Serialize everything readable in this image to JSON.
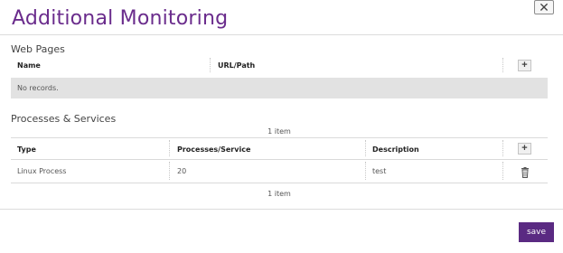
{
  "dialog": {
    "title": "Additional Monitoring",
    "close_label": "✕",
    "save_label": "save"
  },
  "web_pages": {
    "title": "Web Pages",
    "columns": [
      "Name",
      "URL/Path"
    ],
    "add_label": "+",
    "empty_text": "No records."
  },
  "processes": {
    "title": "Processes & Services",
    "pager_top": "1 item",
    "pager_bottom": "1 item",
    "columns": [
      "Type",
      "Processes/Service",
      "Description"
    ],
    "add_label": "+",
    "rows": [
      {
        "type": "Linux Process",
        "service": "20",
        "description": "test"
      }
    ]
  },
  "colors": {
    "title": "#6a2c8c",
    "save_button": "#5a2a82",
    "empty_row": "#e2e2e2"
  },
  "icons": {
    "close": "close-icon",
    "add": "plus-icon",
    "delete": "trash-icon"
  }
}
